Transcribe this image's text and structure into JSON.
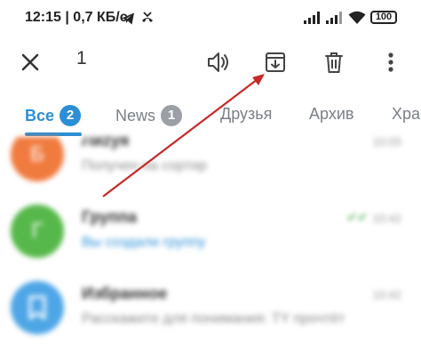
{
  "status_bar": {
    "time_speed": "12:15 | 0,7 КБ/с",
    "battery": "100",
    "icons": [
      "telegram-icon",
      "missed-call-icon",
      "signal-icon",
      "signal-icon",
      "wifi-icon",
      "battery-icon"
    ]
  },
  "action_bar": {
    "selected_count": "1",
    "icons": [
      "close-icon",
      "mute-icon",
      "archive-icon",
      "delete-icon",
      "more-icon"
    ]
  },
  "tabs": [
    {
      "label": "Все",
      "badge": "2",
      "active": true
    },
    {
      "label": "News",
      "badge": "1",
      "active": false
    },
    {
      "label": "Друзья",
      "active": false
    },
    {
      "label": "Архив",
      "active": false
    },
    {
      "label": "Хра",
      "active": false
    }
  ],
  "chats": [
    {
      "avatar_color": "#f07b3f",
      "avatar_letter": "Б",
      "title": "Лиzyя",
      "subtitle": "Получен на сортир",
      "time": "10:05"
    },
    {
      "avatar_color": "#56b84a",
      "avatar_letter": "Г",
      "title": "Группа",
      "subtitle": "Вы создали группу",
      "time": "10:42"
    },
    {
      "avatar_color": "#4ea6e6",
      "avatar_letter": "",
      "title": "Избранное",
      "subtitle": "Расскажите для понимания: TY прочтёт",
      "time": "10:42"
    }
  ],
  "colors": {
    "accent": "#2c8fd6",
    "arrow": "#c62828"
  }
}
